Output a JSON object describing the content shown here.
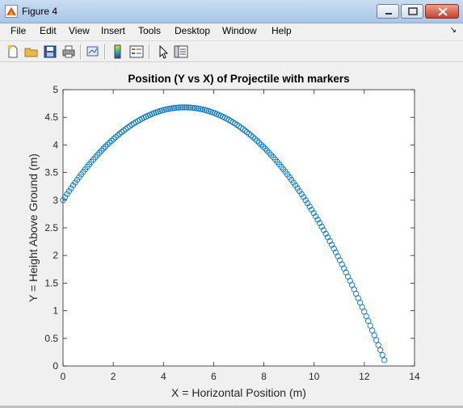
{
  "window": {
    "title": "Figure 4"
  },
  "menu": [
    "File",
    "Edit",
    "View",
    "Insert",
    "Tools",
    "Desktop",
    "Window",
    "Help"
  ],
  "toolbar": {
    "buttons": [
      "new-figure",
      "open-file",
      "save-figure",
      "print-figure",
      "link-plot",
      "insert-colorbar",
      "insert-legend",
      "edit-plot",
      "show-plot-tools"
    ]
  },
  "colors": {
    "marker": "#0072bd",
    "axes_bg": "#ffffff",
    "figure_bg": "#f0f0f0"
  },
  "chart_data": {
    "type": "scatter",
    "title": "Position (Y vs X) of Projectile with markers",
    "xlabel": "X = Horizontal Position (m)",
    "ylabel": "Y = Height Above Ground (m)",
    "xlim": [
      0,
      14
    ],
    "ylim": [
      0,
      5
    ],
    "xticks": [
      "0",
      "2",
      "4",
      "6",
      "8",
      "10",
      "12",
      "14"
    ],
    "yticks": [
      "0",
      "0.5",
      "1",
      "1.5",
      "2",
      "2.5",
      "3",
      "3.5",
      "4",
      "4.5",
      "5"
    ],
    "marker": "circle",
    "grid": false,
    "series": [
      {
        "trajectory": {
          "y0": 3.0,
          "apex_x": 4.83,
          "apex_y": 4.68,
          "x_end": 12.8
        },
        "n_points": 160
      }
    ]
  }
}
